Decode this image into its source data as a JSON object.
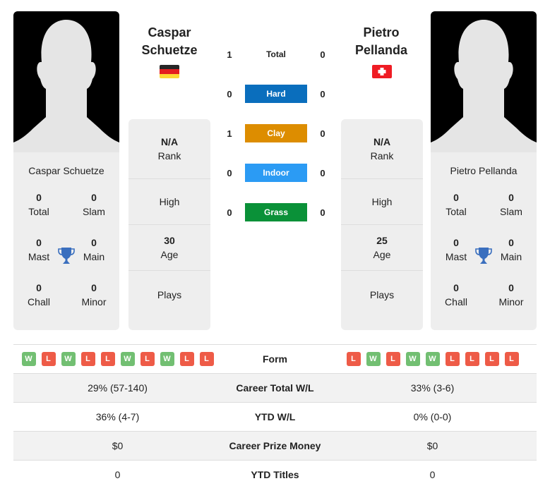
{
  "player1": {
    "name_line1": "Caspar",
    "name_line2": "Schuetze",
    "full_name": "Caspar Schuetze",
    "flag": "germany-flag",
    "titles": {
      "total": "0",
      "total_label": "Total",
      "slam": "0",
      "slam_label": "Slam",
      "mast": "0",
      "mast_label": "Mast",
      "main": "0",
      "main_label": "Main",
      "chall": "0",
      "chall_label": "Chall",
      "minor": "0",
      "minor_label": "Minor"
    },
    "info": {
      "rank_value": "N/A",
      "rank_label": "Rank",
      "high_label": "High",
      "age_value": "30",
      "age_label": "Age",
      "plays_label": "Plays"
    },
    "form": [
      "W",
      "L",
      "W",
      "L",
      "L",
      "W",
      "L",
      "W",
      "L",
      "L"
    ],
    "career_wl": "29% (57-140)",
    "ytd_wl": "36% (4-7)",
    "prize": "$0",
    "ytd_titles": "0"
  },
  "player2": {
    "name_line1": "Pietro",
    "name_line2": "Pellanda",
    "full_name": "Pietro Pellanda",
    "flag": "switzerland-flag",
    "titles": {
      "total": "0",
      "total_label": "Total",
      "slam": "0",
      "slam_label": "Slam",
      "mast": "0",
      "mast_label": "Mast",
      "main": "0",
      "main_label": "Main",
      "chall": "0",
      "chall_label": "Chall",
      "minor": "0",
      "minor_label": "Minor"
    },
    "info": {
      "rank_value": "N/A",
      "rank_label": "Rank",
      "high_label": "High",
      "age_value": "25",
      "age_label": "Age",
      "plays_label": "Plays"
    },
    "form": [
      "L",
      "W",
      "L",
      "W",
      "W",
      "L",
      "L",
      "L",
      "L"
    ],
    "career_wl": "33% (3-6)",
    "ytd_wl": "0% (0-0)",
    "prize": "$0",
    "ytd_titles": "0"
  },
  "h2h": [
    {
      "label": "Total",
      "p1": "1",
      "p2": "0",
      "color": ""
    },
    {
      "label": "Hard",
      "p1": "0",
      "p2": "0",
      "color": "#0a6ebd"
    },
    {
      "label": "Clay",
      "p1": "1",
      "p2": "0",
      "color": "#dd8d00"
    },
    {
      "label": "Indoor",
      "p1": "0",
      "p2": "0",
      "color": "#2b9bf4"
    },
    {
      "label": "Grass",
      "p1": "0",
      "p2": "0",
      "color": "#0a9138"
    }
  ],
  "stats_labels": {
    "form": "Form",
    "career_wl": "Career Total W/L",
    "ytd_wl": "YTD W/L",
    "prize": "Career Prize Money",
    "ytd_titles": "YTD Titles"
  }
}
